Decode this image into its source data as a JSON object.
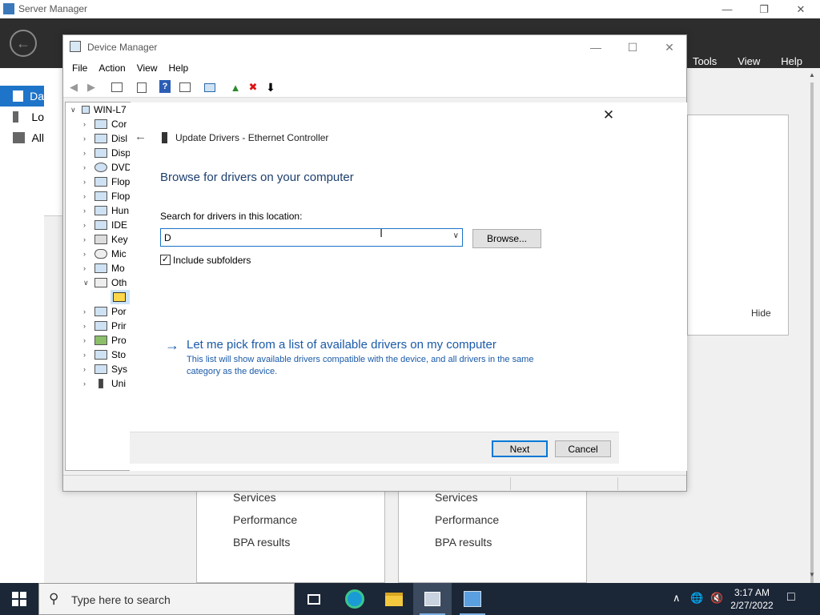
{
  "server_manager": {
    "title": "Server Manager",
    "menu": [
      "Tools",
      "View",
      "Help"
    ],
    "left_nav": [
      "Da",
      "Lo",
      "All"
    ],
    "hide_label": "Hide",
    "tiles": [
      {
        "items": [
          "Services",
          "Performance",
          "BPA results"
        ]
      },
      {
        "items": [
          "Services",
          "Performance",
          "BPA results"
        ]
      }
    ]
  },
  "device_manager": {
    "title": "Device Manager",
    "menu": [
      "File",
      "Action",
      "View",
      "Help"
    ],
    "tree": {
      "root": "WIN-L7",
      "nodes": [
        {
          "label": "Cor",
          "expanded": false
        },
        {
          "label": "Disl",
          "expanded": false
        },
        {
          "label": "Disp",
          "expanded": false
        },
        {
          "label": "DVD",
          "expanded": false
        },
        {
          "label": "Flop",
          "expanded": false
        },
        {
          "label": "Flop",
          "expanded": false
        },
        {
          "label": "Hun",
          "expanded": false
        },
        {
          "label": "IDE",
          "expanded": false
        },
        {
          "label": "Key",
          "expanded": false
        },
        {
          "label": "Mic",
          "expanded": false
        },
        {
          "label": "Mo",
          "expanded": false
        },
        {
          "label": "Oth",
          "expanded": true
        },
        {
          "label": "",
          "expanded": false,
          "child": true
        },
        {
          "label": "Por",
          "expanded": false
        },
        {
          "label": "Prir",
          "expanded": false
        },
        {
          "label": "Pro",
          "expanded": false
        },
        {
          "label": "Sto",
          "expanded": false
        },
        {
          "label": "Sys",
          "expanded": false
        },
        {
          "label": "Uni",
          "expanded": false
        }
      ]
    }
  },
  "wizard": {
    "title": "Update Drivers - Ethernet Controller",
    "heading": "Browse for drivers on your computer",
    "location_label": "Search for drivers in this location:",
    "location_value": "D",
    "browse_label": "Browse...",
    "include_subfolders_label": "Include subfolders",
    "include_subfolders_checked": true,
    "pick_link": "Let me pick from a list of available drivers on my computer",
    "pick_description": "This list will show available drivers compatible with the device, and all drivers in the same category as the device.",
    "next_label": "Next",
    "cancel_label": "Cancel"
  },
  "taskbar": {
    "search_placeholder": "Type here to search",
    "time": "3:17 AM",
    "date": "2/27/2022"
  },
  "colors": {
    "accent": "#1e74c8",
    "link": "#1a5aa8",
    "heading": "#1d3f6e",
    "sm_header": "#2d2d2d",
    "taskbar": "#1b2637"
  }
}
